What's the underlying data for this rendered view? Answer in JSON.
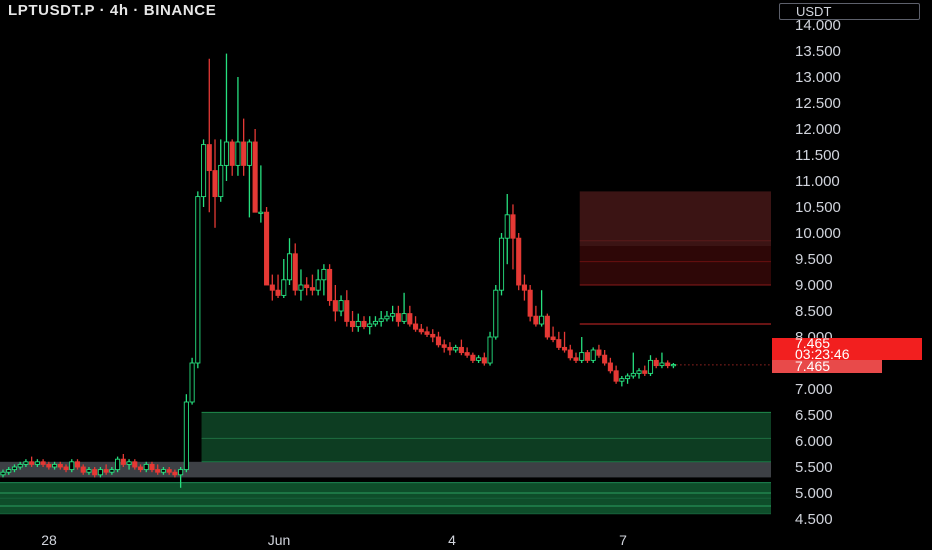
{
  "header": {
    "title": "LPTUSDT.P · 4h · BINANCE",
    "currency": "USDT"
  },
  "price_label": {
    "price": "7.465",
    "countdown": "03:23:46",
    "price2": "7.465"
  },
  "colors": {
    "background": "#000000",
    "up": "#26e07f",
    "down": "#e53935",
    "supply_zone": "#3b1414",
    "demand_zone": "#0f4a28",
    "price_tag": "#f21f1f"
  },
  "chart_data": {
    "type": "candlestick",
    "title": "LPTUSDT.P · 4h · BINANCE",
    "ylabel": "USDT",
    "ylim": [
      4.3,
      14.1
    ],
    "y_ticks": [
      "14.000",
      "13.500",
      "13.000",
      "12.500",
      "12.000",
      "11.500",
      "11.000",
      "10.500",
      "10.000",
      "9.500",
      "9.000",
      "8.500",
      "8.000",
      "7.500",
      "7.000",
      "6.500",
      "6.000",
      "5.500",
      "5.000",
      "4.500"
    ],
    "x_ticks": [
      "28",
      "Jun",
      "4",
      "7"
    ],
    "current_price": 7.465,
    "candles": [
      [
        5.35,
        5.45,
        5.3,
        5.4
      ],
      [
        5.4,
        5.5,
        5.35,
        5.45
      ],
      [
        5.45,
        5.55,
        5.4,
        5.5
      ],
      [
        5.5,
        5.6,
        5.45,
        5.55
      ],
      [
        5.55,
        5.65,
        5.5,
        5.6
      ],
      [
        5.6,
        5.7,
        5.5,
        5.55
      ],
      [
        5.55,
        5.65,
        5.5,
        5.6
      ],
      [
        5.6,
        5.65,
        5.5,
        5.55
      ],
      [
        5.55,
        5.6,
        5.45,
        5.5
      ],
      [
        5.5,
        5.6,
        5.45,
        5.55
      ],
      [
        5.55,
        5.6,
        5.45,
        5.5
      ],
      [
        5.5,
        5.55,
        5.4,
        5.45
      ],
      [
        5.45,
        5.65,
        5.4,
        5.6
      ],
      [
        5.6,
        5.65,
        5.45,
        5.5
      ],
      [
        5.5,
        5.55,
        5.35,
        5.4
      ],
      [
        5.4,
        5.5,
        5.35,
        5.45
      ],
      [
        5.45,
        5.5,
        5.3,
        5.35
      ],
      [
        5.35,
        5.5,
        5.3,
        5.45
      ],
      [
        5.45,
        5.55,
        5.35,
        5.4
      ],
      [
        5.4,
        5.5,
        5.35,
        5.45
      ],
      [
        5.45,
        5.7,
        5.4,
        5.65
      ],
      [
        5.65,
        5.75,
        5.5,
        5.55
      ],
      [
        5.55,
        5.65,
        5.45,
        5.6
      ],
      [
        5.6,
        5.65,
        5.45,
        5.5
      ],
      [
        5.5,
        5.55,
        5.4,
        5.45
      ],
      [
        5.45,
        5.6,
        5.4,
        5.55
      ],
      [
        5.55,
        5.6,
        5.4,
        5.45
      ],
      [
        5.45,
        5.55,
        5.35,
        5.4
      ],
      [
        5.4,
        5.5,
        5.35,
        5.45
      ],
      [
        5.45,
        5.5,
        5.35,
        5.4
      ],
      [
        5.4,
        5.45,
        5.3,
        5.35
      ],
      [
        5.35,
        5.5,
        5.1,
        5.45
      ],
      [
        5.45,
        6.9,
        5.4,
        6.75
      ],
      [
        6.75,
        7.6,
        6.7,
        7.5
      ],
      [
        7.5,
        10.8,
        7.4,
        10.7
      ],
      [
        10.7,
        11.8,
        10.5,
        11.7
      ],
      [
        11.7,
        13.35,
        10.4,
        11.2
      ],
      [
        11.2,
        11.8,
        10.1,
        10.7
      ],
      [
        10.7,
        11.8,
        10.6,
        11.3
      ],
      [
        11.3,
        13.45,
        11.0,
        11.75
      ],
      [
        11.75,
        11.8,
        11.1,
        11.3
      ],
      [
        11.3,
        13.0,
        11.1,
        11.75
      ],
      [
        11.75,
        12.2,
        11.1,
        11.3
      ],
      [
        11.3,
        11.8,
        10.3,
        11.75
      ],
      [
        11.75,
        12.0,
        10.4,
        10.4
      ],
      [
        10.4,
        11.3,
        10.2,
        10.4
      ],
      [
        10.4,
        10.5,
        9.0,
        9.0
      ],
      [
        9.0,
        9.2,
        8.7,
        8.9
      ],
      [
        8.9,
        9.2,
        8.75,
        8.8
      ],
      [
        8.8,
        9.5,
        8.75,
        9.1
      ],
      [
        9.1,
        9.9,
        9.0,
        9.6
      ],
      [
        9.6,
        9.8,
        8.8,
        8.9
      ],
      [
        8.9,
        9.3,
        8.7,
        9.0
      ],
      [
        9.0,
        9.15,
        8.8,
        8.95
      ],
      [
        8.95,
        9.2,
        8.8,
        8.9
      ],
      [
        8.9,
        9.3,
        8.8,
        9.1
      ],
      [
        9.1,
        9.4,
        8.8,
        9.3
      ],
      [
        9.3,
        9.4,
        8.6,
        8.7
      ],
      [
        8.7,
        9.0,
        8.3,
        8.5
      ],
      [
        8.5,
        8.8,
        8.4,
        8.7
      ],
      [
        8.7,
        8.9,
        8.2,
        8.3
      ],
      [
        8.3,
        8.5,
        8.1,
        8.2
      ],
      [
        8.2,
        8.45,
        8.1,
        8.3
      ],
      [
        8.3,
        8.4,
        8.15,
        8.2
      ],
      [
        8.2,
        8.4,
        8.05,
        8.25
      ],
      [
        8.25,
        8.4,
        8.2,
        8.3
      ],
      [
        8.3,
        8.5,
        8.2,
        8.35
      ],
      [
        8.35,
        8.5,
        8.3,
        8.4
      ],
      [
        8.4,
        8.6,
        8.3,
        8.45
      ],
      [
        8.45,
        8.6,
        8.2,
        8.3
      ],
      [
        8.3,
        8.85,
        8.25,
        8.45
      ],
      [
        8.45,
        8.6,
        8.2,
        8.25
      ],
      [
        8.25,
        8.4,
        8.1,
        8.15
      ],
      [
        8.15,
        8.25,
        8.05,
        8.1
      ],
      [
        8.1,
        8.2,
        8.0,
        8.05
      ],
      [
        8.05,
        8.15,
        7.9,
        8.0
      ],
      [
        8.0,
        8.1,
        7.8,
        7.85
      ],
      [
        7.85,
        7.95,
        7.7,
        7.8
      ],
      [
        7.8,
        7.9,
        7.65,
        7.75
      ],
      [
        7.75,
        7.85,
        7.7,
        7.8
      ],
      [
        7.8,
        7.95,
        7.65,
        7.7
      ],
      [
        7.7,
        7.8,
        7.6,
        7.65
      ],
      [
        7.65,
        7.7,
        7.5,
        7.55
      ],
      [
        7.55,
        7.65,
        7.5,
        7.6
      ],
      [
        7.6,
        7.7,
        7.45,
        7.5
      ],
      [
        7.5,
        8.1,
        7.45,
        8.0
      ],
      [
        8.0,
        9.0,
        7.95,
        8.9
      ],
      [
        8.9,
        10.0,
        8.8,
        9.9
      ],
      [
        9.9,
        10.75,
        9.4,
        10.35
      ],
      [
        10.35,
        10.55,
        9.3,
        9.9
      ],
      [
        9.9,
        10.0,
        8.9,
        9.0
      ],
      [
        9.0,
        9.2,
        8.7,
        8.9
      ],
      [
        8.9,
        9.0,
        8.3,
        8.4
      ],
      [
        8.4,
        8.6,
        8.2,
        8.25
      ],
      [
        8.25,
        8.9,
        8.2,
        8.4
      ],
      [
        8.4,
        8.45,
        7.95,
        8.0
      ],
      [
        8.0,
        8.2,
        7.9,
        7.95
      ],
      [
        7.95,
        8.1,
        7.75,
        7.8
      ],
      [
        7.8,
        8.1,
        7.7,
        7.75
      ],
      [
        7.75,
        7.85,
        7.55,
        7.6
      ],
      [
        7.6,
        7.7,
        7.5,
        7.55
      ],
      [
        7.55,
        8.0,
        7.5,
        7.7
      ],
      [
        7.7,
        7.75,
        7.5,
        7.55
      ],
      [
        7.55,
        7.8,
        7.5,
        7.75
      ],
      [
        7.75,
        7.85,
        7.6,
        7.65
      ],
      [
        7.65,
        7.75,
        7.45,
        7.5
      ],
      [
        7.5,
        7.6,
        7.3,
        7.35
      ],
      [
        7.35,
        7.45,
        7.1,
        7.15
      ],
      [
        7.15,
        7.25,
        7.05,
        7.2
      ],
      [
        7.2,
        7.3,
        7.1,
        7.25
      ],
      [
        7.25,
        7.7,
        7.2,
        7.3
      ],
      [
        7.3,
        7.4,
        7.2,
        7.35
      ],
      [
        7.35,
        7.45,
        7.25,
        7.3
      ],
      [
        7.3,
        7.65,
        7.25,
        7.55
      ],
      [
        7.55,
        7.6,
        7.4,
        7.45
      ],
      [
        7.45,
        7.7,
        7.4,
        7.5
      ],
      [
        7.5,
        7.55,
        7.4,
        7.45
      ],
      [
        7.45,
        7.5,
        7.4,
        7.47
      ]
    ],
    "zones": [
      {
        "name": "supply-zone-upper",
        "from": 10.8,
        "to": 9.75,
        "x_from_candle": 101,
        "fill": "#3b1414"
      },
      {
        "name": "supply-zone-lower",
        "from": 9.75,
        "to": 9.0,
        "x_from_candle": 101,
        "fill": "#2e0707"
      },
      {
        "name": "demand-zone-upper",
        "from": 6.55,
        "to": 5.6,
        "x_from_candle": 35,
        "fill": "#0d3d22"
      },
      {
        "name": "demand-zone-gray",
        "from": 5.6,
        "to": 5.3,
        "x_from_candle": 0,
        "fill": "#3d4045"
      },
      {
        "name": "demand-zone-lower",
        "from": 5.2,
        "to": 4.6,
        "x_from_candle": 0,
        "fill": "#0e4d2a"
      }
    ]
  }
}
